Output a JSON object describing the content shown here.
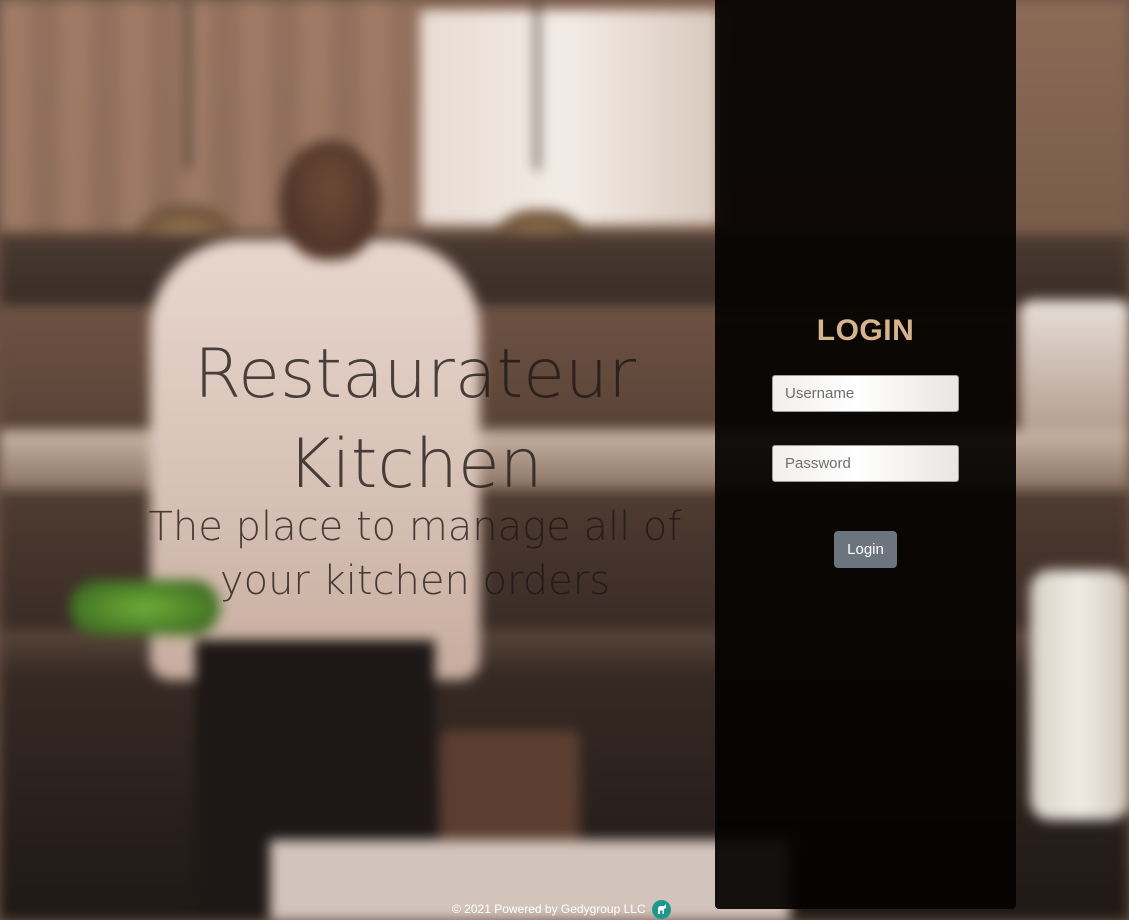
{
  "hero": {
    "title_line1": "Restaurateur",
    "title_line2": "Kitchen",
    "subtitle": "The place to manage all of your kitchen orders"
  },
  "login": {
    "heading": "LOGIN",
    "username_placeholder": "Username",
    "password_placeholder": "Password",
    "button_label": "Login"
  },
  "footer": {
    "text": "© 2021 Powered by Gedygroup LLC",
    "logo_icon": "gedygroup-logo-icon"
  },
  "colors": {
    "heading_accent": "#d6b58d",
    "button_bg": "#6c757d",
    "logo_bg": "#1a9a8c"
  }
}
